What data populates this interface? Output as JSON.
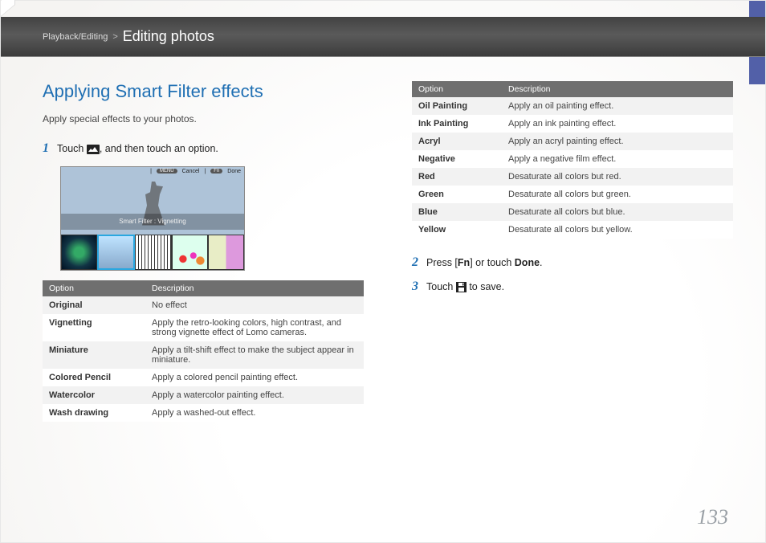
{
  "breadcrumb": {
    "section": "Playback/Editing",
    "sep": ">",
    "page": "Editing photos"
  },
  "title": "Applying Smart Filter effects",
  "intro": "Apply special effects to your photos.",
  "steps": {
    "s1_pre": "Touch ",
    "s1_post": ", and then touch an option.",
    "s2_pre": "Press [",
    "s2_mid_fn": "Fn",
    "s2_mid": "] or touch ",
    "s2_bold": "Done",
    "s2_post": ".",
    "s3_pre": "Touch ",
    "s3_post": " to save."
  },
  "mock": {
    "menu_pill": "MENU",
    "cancel": "Cancel",
    "fn_pill": "Fn",
    "done": "Done",
    "band": "Smart Filter : Vignetting"
  },
  "table_headers": {
    "option": "Option",
    "description": "Description"
  },
  "left_table": [
    {
      "name": "Original",
      "desc": "No effect"
    },
    {
      "name": "Vignetting",
      "desc": "Apply the retro-looking colors, high contrast, and strong vignette effect of Lomo cameras."
    },
    {
      "name": "Miniature",
      "desc": "Apply a tilt-shift effect to make the subject appear in miniature."
    },
    {
      "name": "Colored Pencil",
      "desc": "Apply a colored pencil painting effect."
    },
    {
      "name": "Watercolor",
      "desc": "Apply a watercolor painting effect."
    },
    {
      "name": "Wash drawing",
      "desc": "Apply a washed-out effect."
    }
  ],
  "right_table": [
    {
      "name": "Oil Painting",
      "desc": "Apply an oil painting effect."
    },
    {
      "name": "Ink Painting",
      "desc": "Apply an ink painting effect."
    },
    {
      "name": "Acryl",
      "desc": "Apply an acryl painting effect."
    },
    {
      "name": "Negative",
      "desc": "Apply a negative film effect."
    },
    {
      "name": "Red",
      "desc": "Desaturate all colors but red."
    },
    {
      "name": "Green",
      "desc": "Desaturate all colors but green."
    },
    {
      "name": "Blue",
      "desc": "Desaturate all colors but blue."
    },
    {
      "name": "Yellow",
      "desc": "Desaturate all colors but yellow."
    }
  ],
  "page_number": "133"
}
